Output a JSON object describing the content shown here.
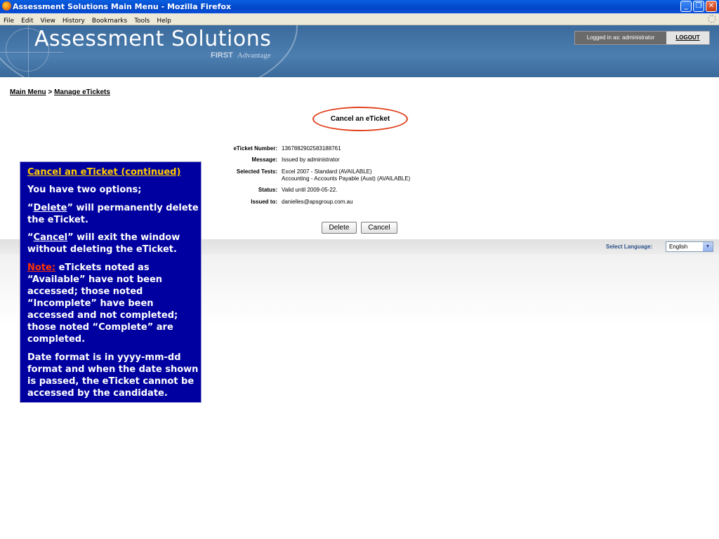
{
  "window": {
    "title": "Assessment Solutions Main Menu - Mozilla Firefox",
    "menus": [
      "File",
      "Edit",
      "View",
      "History",
      "Bookmarks",
      "Tools",
      "Help"
    ],
    "buttons": {
      "minimize": "_",
      "restore": "❐",
      "close": "✕"
    }
  },
  "header": {
    "brand": "Assessment Solutions",
    "sub_first": "FIRST",
    "sub_advantage": "Advantage",
    "logged_in": "Logged in as: administrator",
    "logout": "LOGOUT"
  },
  "breadcrumb": {
    "main_menu": "Main Menu",
    "separator": ">",
    "current": "Manage eTickets"
  },
  "page": {
    "heading": "Cancel an eTicket",
    "fields": {
      "ticket_number_label": "eTicket Number:",
      "ticket_number": "1367882902583188761",
      "message_label": "Message:",
      "message": "Issued by administrator",
      "tests_label": "Selected Tests:",
      "test1": "Excel 2007 - Standard (AVAILABLE)",
      "test2": "Accounting - Accounts Payable (Aust) (AVAILABLE)",
      "status_label": "Status:",
      "status": "Valid until 2009-05-22.",
      "issued_label": "Issued to:",
      "issued_to": "danielles@apsgroup.com.au"
    },
    "delete_button": "Delete",
    "cancel_button": "Cancel"
  },
  "language": {
    "label": "Select Language:",
    "selected": "English"
  },
  "callout": {
    "title": "Cancel an eTicket (continued)",
    "intro": "You have two options;",
    "delete_open": "“",
    "delete_word": "Delete",
    "delete_rest": "” will permanently delete the eTicket.",
    "cancel_open": "“",
    "cancel_word": "Cancel",
    "cancel_rest": "” will exit the window without deleting the eTicket.",
    "note_label": "Note:",
    "note_text": " eTickets noted as “Available” have not been accessed; those noted “Incomplete” have been accessed and not completed; those noted “Complete” are completed.",
    "date_text": "Date format is in yyyy-mm-dd format and when the date shown is passed, the eTicket cannot be accessed by the candidate."
  },
  "colors": {
    "callout_bg": "#0000a0",
    "callout_title": "#ffcc00",
    "note": "#ff3300",
    "highlight_ellipse": "#e0401a",
    "banner": "#4c7eb0"
  }
}
